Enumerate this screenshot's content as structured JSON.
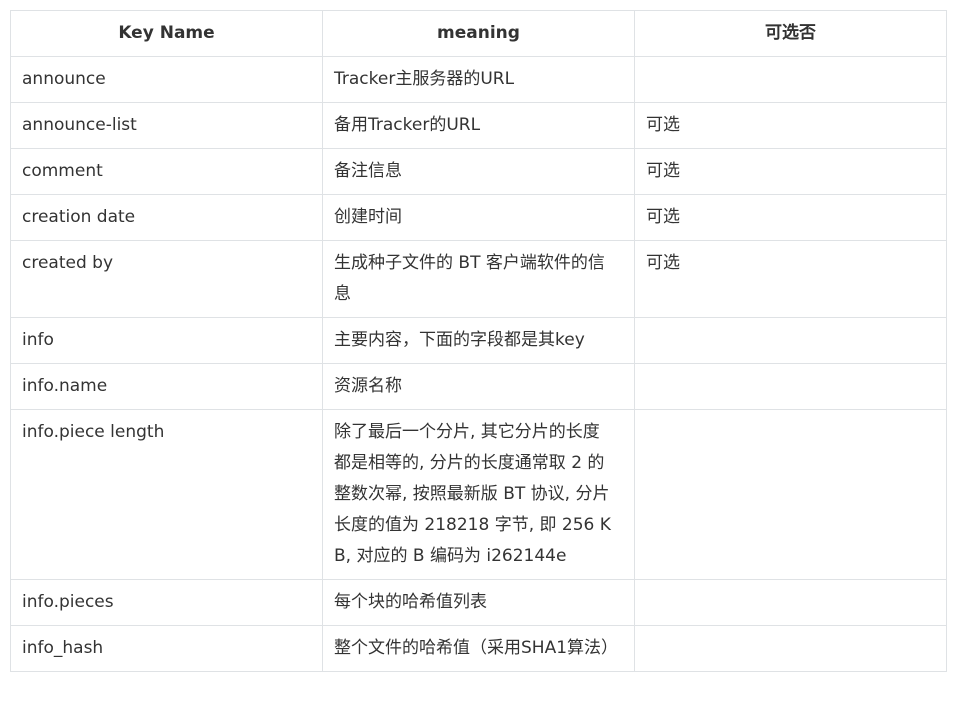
{
  "table": {
    "headers": [
      "Key Name",
      "meaning",
      "可选否"
    ],
    "rows": [
      {
        "key": "announce",
        "meaning": "Tracker主服务器的URL",
        "optional": ""
      },
      {
        "key": "announce-list",
        "meaning": "备用Tracker的URL",
        "optional": "可选"
      },
      {
        "key": "comment",
        "meaning": "备注信息",
        "optional": "可选"
      },
      {
        "key": "creation date",
        "meaning": "创建时间",
        "optional": "可选"
      },
      {
        "key": "created by",
        "meaning": "生成种子文件的 BT 客户端软件的信息",
        "optional": "可选"
      },
      {
        "key": "info",
        "meaning": "主要内容，下面的字段都是其key",
        "optional": ""
      },
      {
        "key": "info.name",
        "meaning": "资源名称",
        "optional": ""
      },
      {
        "key": "info.piece length",
        "meaning": "除了最后一个分片, 其它分片的长度都是相等的, 分片的长度通常取 2 的整数次幂, 按照最新版 BT 协议, 分片长度的值为 218218 字节, 即 256 KB, 对应的 B 编码为 i262144e",
        "optional": ""
      },
      {
        "key": "info.pieces",
        "meaning": "每个块的哈希值列表",
        "optional": ""
      },
      {
        "key": "info_hash",
        "meaning": "整个文件的哈希值（采用SHA1算法）",
        "optional": ""
      }
    ]
  }
}
